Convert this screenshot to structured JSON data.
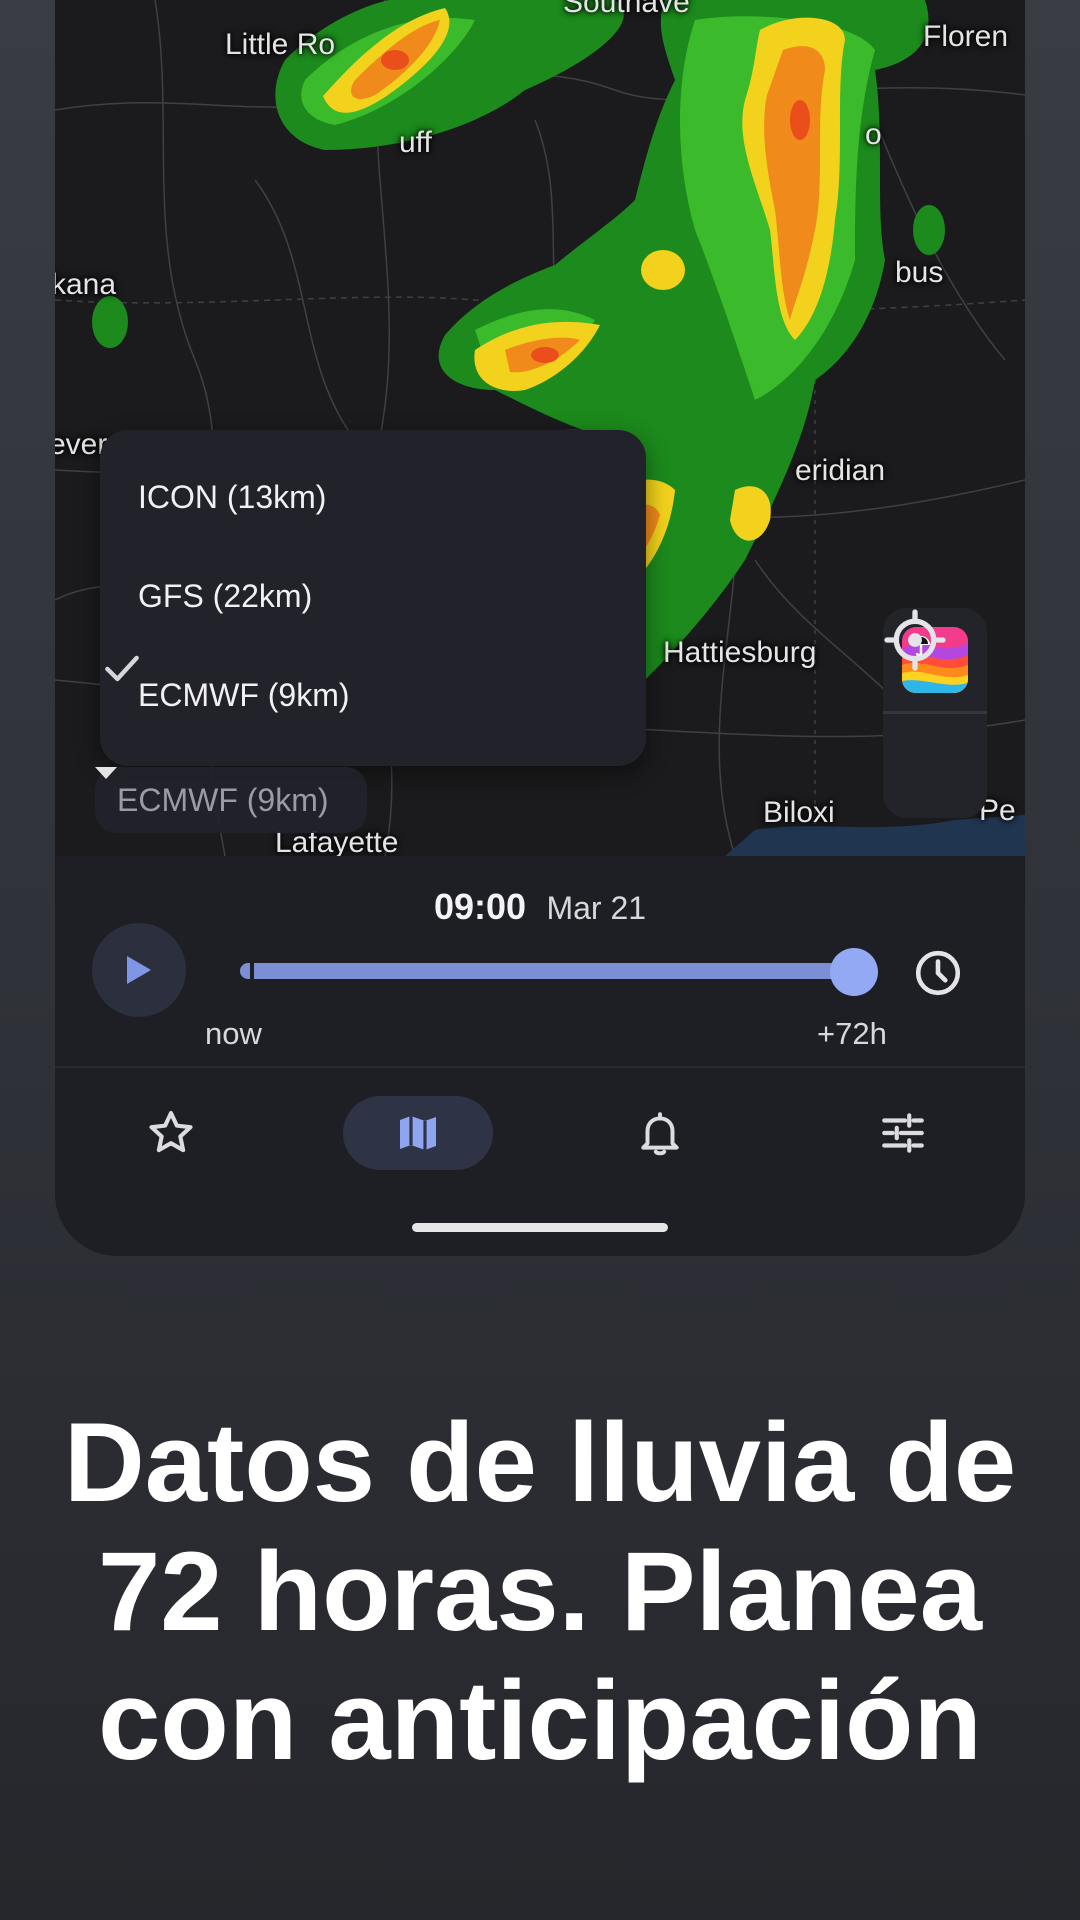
{
  "map": {
    "cities": [
      "Little Ro",
      "Southave",
      "Floren",
      "uff",
      "o",
      "kana",
      "bus",
      "ever",
      "eridian",
      "Hattiesburg",
      "Biloxi",
      "Pe",
      "Lafayette"
    ]
  },
  "model_menu": {
    "options": [
      {
        "label": "ICON (13km)",
        "selected": false
      },
      {
        "label": "GFS (22km)",
        "selected": false
      },
      {
        "label": "ECMWF (9km)",
        "selected": true
      }
    ],
    "current_value": "ECMWF (9km)"
  },
  "side_controls": {
    "app_icon": "rainbow-umbrella-icon",
    "locate_icon": "crosshair-icon"
  },
  "timeline": {
    "time": "09:00",
    "date": "Mar 21",
    "start_label": "now",
    "end_label": "+72h",
    "position_fraction": 1.0,
    "accent_color": "#93a9f3"
  },
  "nav": {
    "items": [
      {
        "icon": "star-icon",
        "active": false
      },
      {
        "icon": "map-icon",
        "active": true
      },
      {
        "icon": "bell-icon",
        "active": false
      },
      {
        "icon": "sliders-icon",
        "active": false
      }
    ]
  },
  "headline": "Datos de lluvia de 72 horas. Planea con anticipación"
}
